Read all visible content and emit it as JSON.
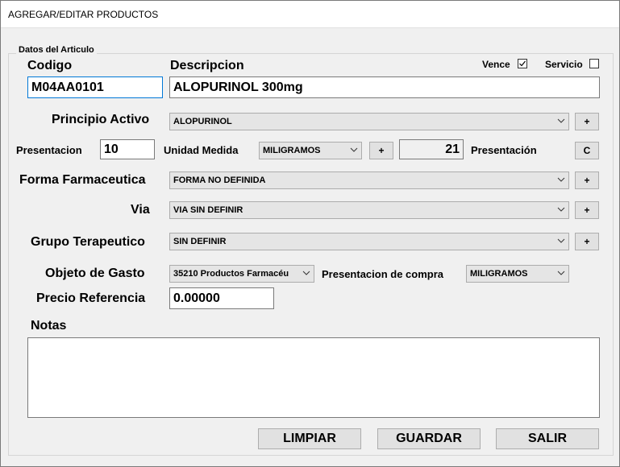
{
  "window": {
    "title": "AGREGAR/EDITAR PRODUCTOS"
  },
  "group": {
    "title": "Datos del Articulo"
  },
  "codigo": {
    "label": "Codigo",
    "value": "M04AA0101"
  },
  "descripcion": {
    "label": "Descripcion",
    "value": "ALOPURINOL 300mg"
  },
  "vence": {
    "label": "Vence",
    "checked": true
  },
  "servicio": {
    "label": "Servicio",
    "checked": false
  },
  "principio_activo": {
    "label": "Principio Activo",
    "value": "ALOPURINOL",
    "add_label": "+"
  },
  "presentacion": {
    "label": "Presentacion",
    "value": "10"
  },
  "unidad_medida": {
    "label": "Unidad Medida",
    "value": "MILIGRAMOS",
    "add_label": "+"
  },
  "presentacion_count": {
    "value": "21",
    "label": "Presentación",
    "button_label": "C"
  },
  "forma_farmaceutica": {
    "label": "Forma Farmaceutica",
    "value": "FORMA NO DEFINIDA",
    "add_label": "+"
  },
  "via": {
    "label": "Via",
    "value": "VIA SIN DEFINIR",
    "add_label": "+"
  },
  "grupo_terapeutico": {
    "label": "Grupo Terapeutico",
    "value": "SIN DEFINIR",
    "add_label": "+"
  },
  "objeto_gasto": {
    "label": "Objeto de Gasto",
    "value": "35210 Productos Farmacéu"
  },
  "presentacion_compra": {
    "label": "Presentacion de compra",
    "value": "MILIGRAMOS"
  },
  "precio_referencia": {
    "label": "Precio Referencia",
    "value": "0.00000"
  },
  "notas": {
    "label": "Notas",
    "value": ""
  },
  "buttons": {
    "limpiar": "LIMPIAR",
    "guardar": "GUARDAR",
    "salir": "SALIR"
  },
  "colors": {
    "focus_border": "#0078d7",
    "window_bg": "#f0f0f0",
    "button_bg": "#e1e1e1"
  }
}
